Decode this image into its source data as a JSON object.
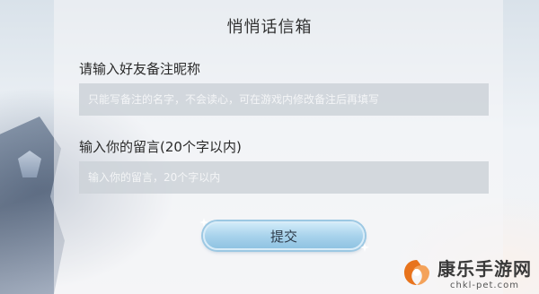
{
  "dialog": {
    "title": "悄悄话信箱",
    "nickname_label": "请输入好友备注昵称",
    "nickname_placeholder": "只能写备注的名字，不会读心，可在游戏内修改备注后再填写",
    "message_label": "输入你的留言(20个字以内)",
    "message_placeholder": "输入你的留言，20个字以内",
    "submit_label": "提交"
  },
  "watermark": {
    "name": "康乐手游网",
    "url": "chkl-pet.com"
  },
  "colors": {
    "field_bg": "#cdd2d8",
    "button_top": "#cfeaf8",
    "button_bottom": "#8fc3e2",
    "logo_orange": "#e8731c"
  },
  "icons": {
    "watermark_logo": "orange-swirl-logo",
    "button_sparkles": "sparkle-star"
  }
}
